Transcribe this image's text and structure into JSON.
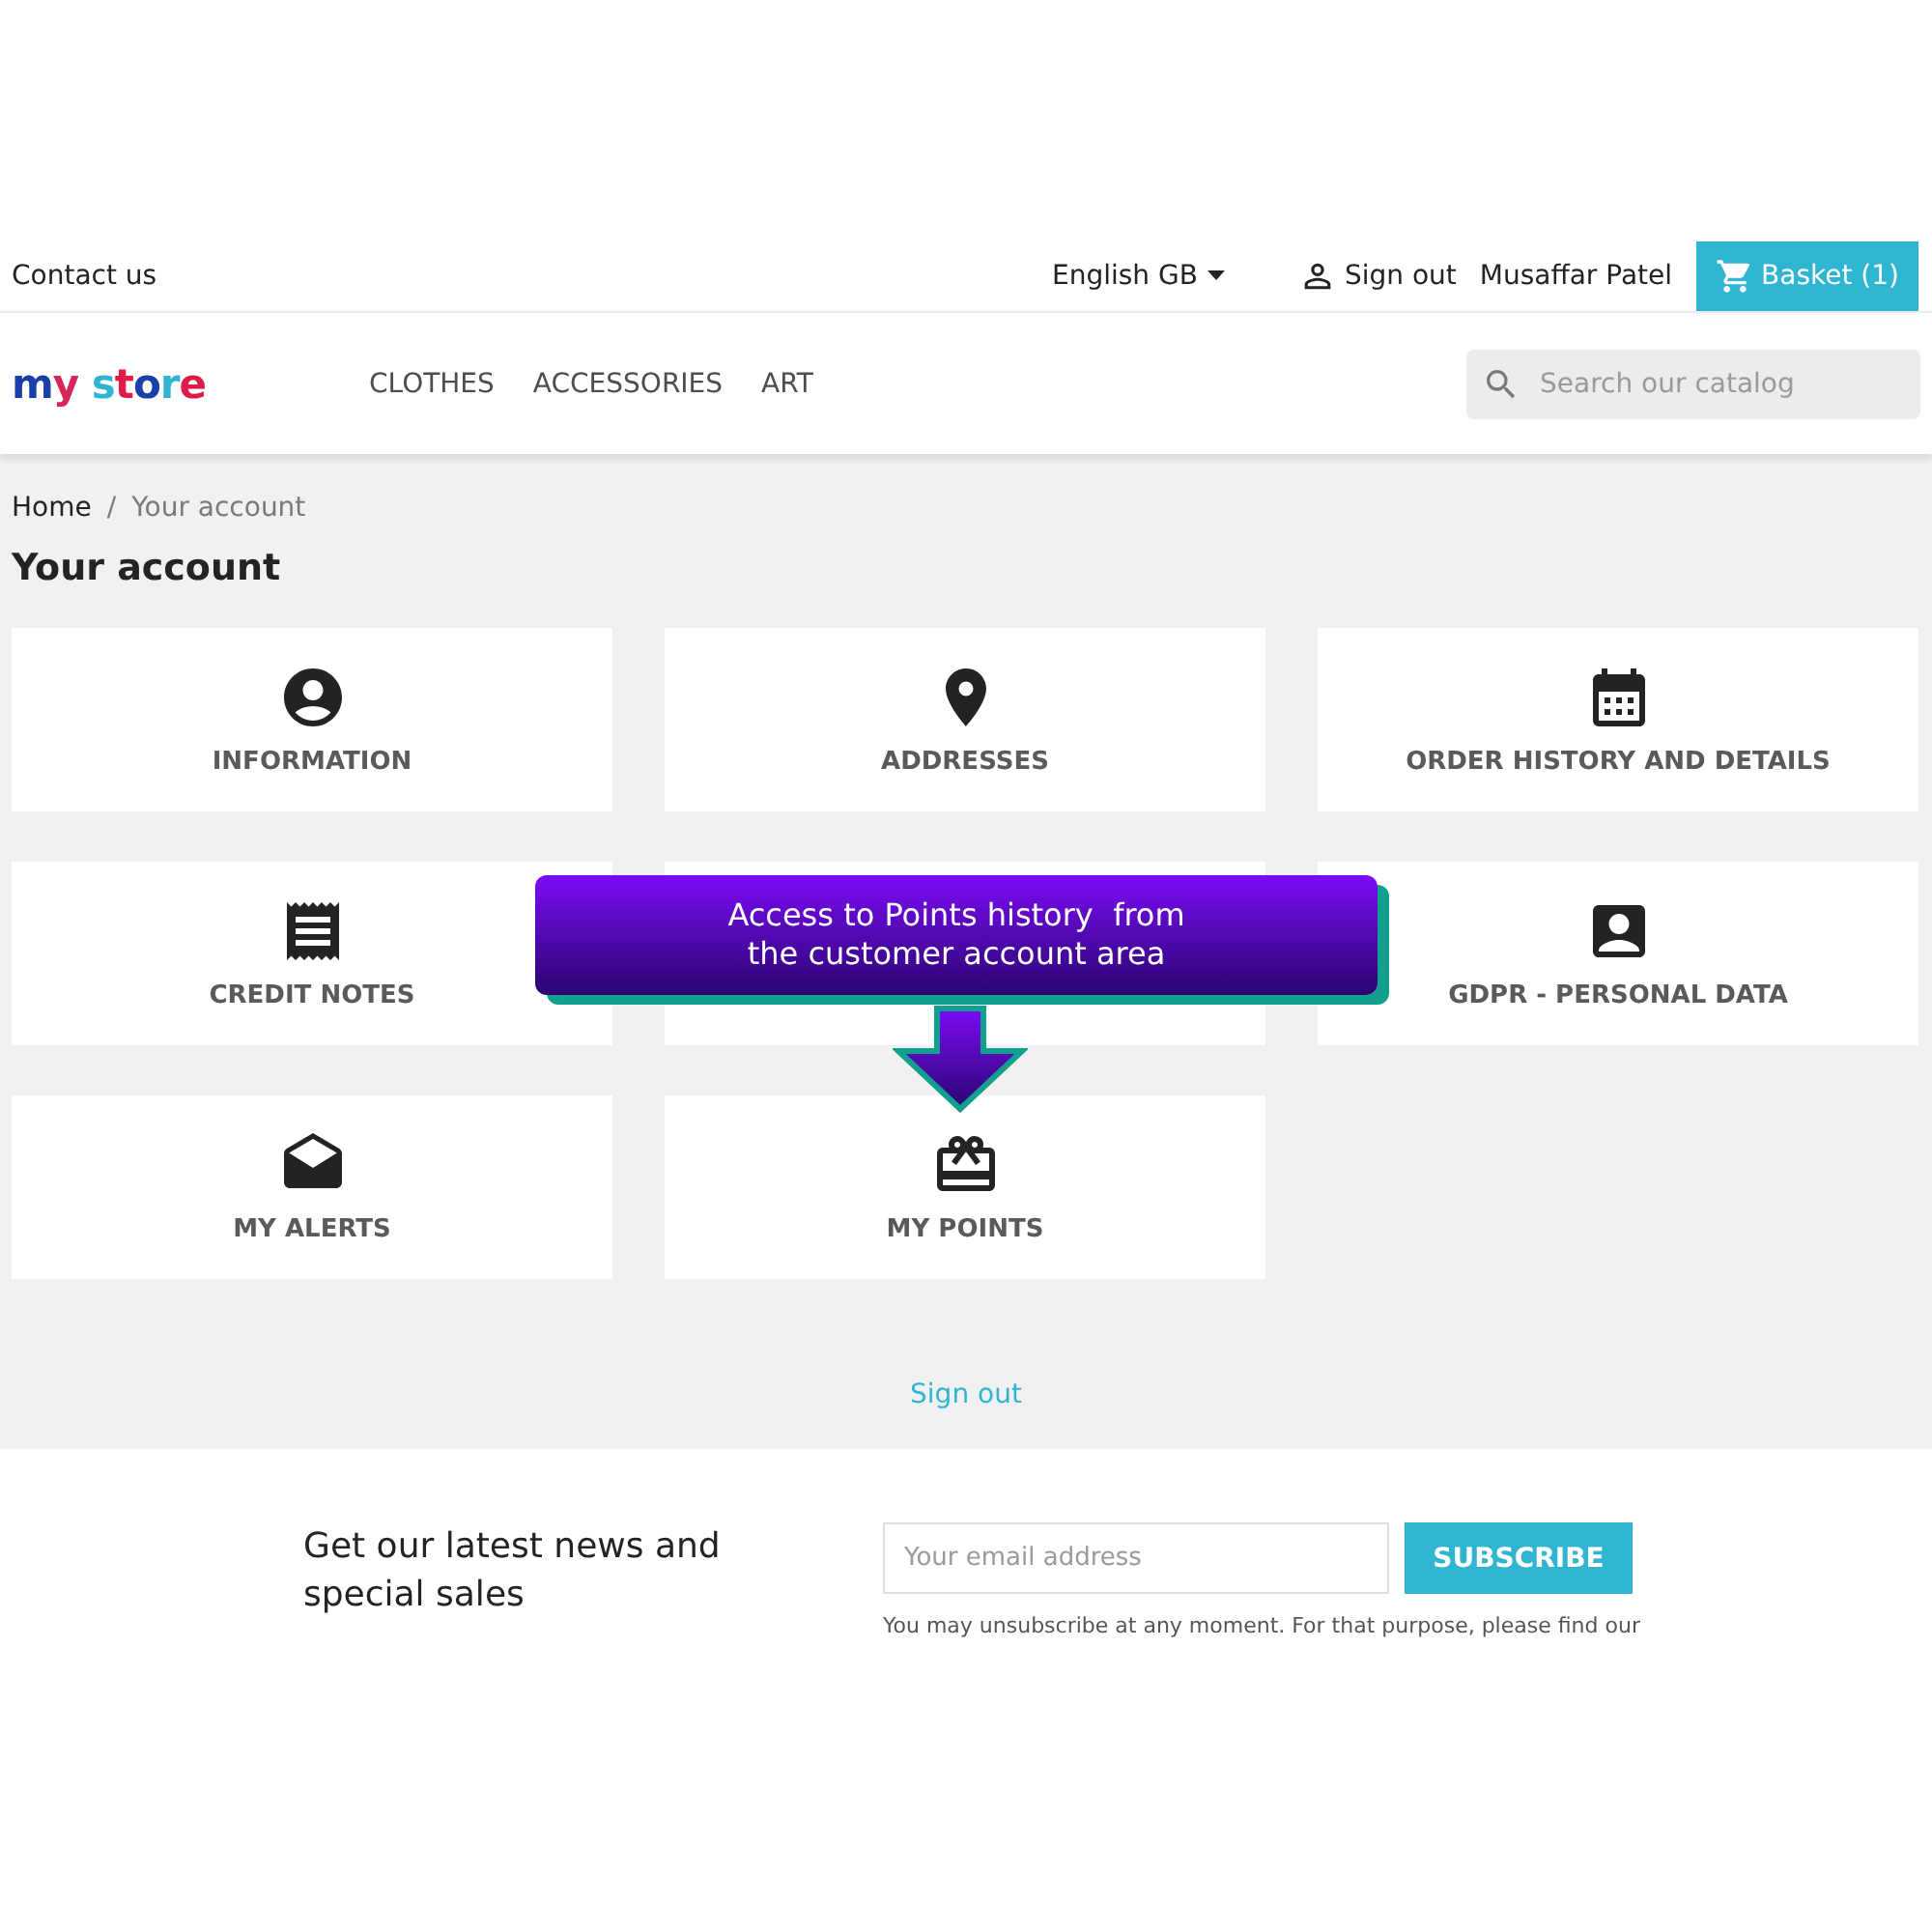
{
  "top_bar": {
    "contact": "Contact us",
    "language": "English GB",
    "sign_out": "Sign out",
    "user": "Musaffar Patel",
    "basket": "Basket (1)"
  },
  "header": {
    "logo": "my store",
    "menu": [
      "CLOTHES",
      "ACCESSORIES",
      "ART"
    ],
    "search": {
      "placeholder": "Search our catalog"
    }
  },
  "breadcrumb": {
    "items": [
      "Home",
      "Your account"
    ],
    "separator": "/"
  },
  "page_title": "Your account",
  "cards": [
    {
      "kind": "person",
      "label": "INFORMATION"
    },
    {
      "kind": "pin",
      "label": "ADDRESSES"
    },
    {
      "kind": "calendar",
      "label": "ORDER HISTORY AND DETAILS"
    },
    {
      "kind": "receipt",
      "label": "CREDIT NOTES"
    },
    {
      "kind": "hidden"
    },
    {
      "kind": "badge",
      "label": "GDPR - PERSONAL DATA"
    },
    {
      "kind": "mail",
      "label": "MY ALERTS"
    },
    {
      "kind": "gift",
      "label": "MY POINTS"
    }
  ],
  "callout": {
    "lines": [
      "Access to Points history  from",
      "the customer account area"
    ]
  },
  "sign_out_link": "Sign out",
  "newsletter": {
    "heading": "Get our latest news and special sales",
    "email": {
      "placeholder": "Your email address"
    },
    "button": "SUBSCRIBE",
    "note": "You may unsubscribe at any moment. For that purpose, please find our"
  }
}
